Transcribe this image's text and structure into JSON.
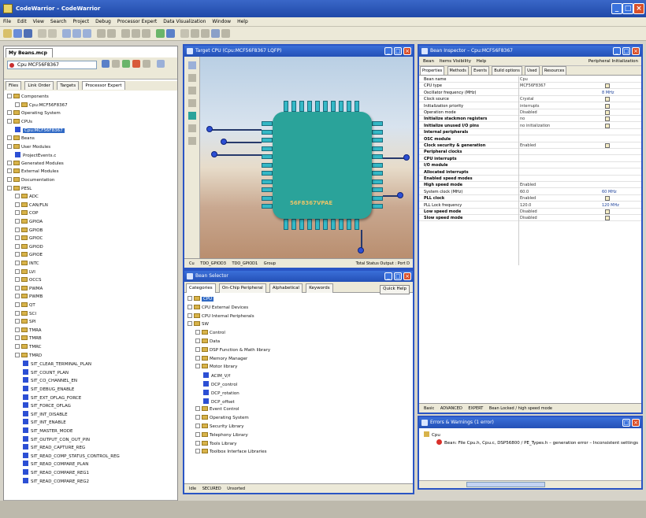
{
  "window": {
    "title": "CodeWarrior – CodeWarrior"
  },
  "menu": [
    "File",
    "Edit",
    "View",
    "Search",
    "Project",
    "Debug",
    "Processor Expert",
    "Data Visualization",
    "Window",
    "Help"
  ],
  "project_panel": {
    "tab": "My Beans.mcp",
    "cpu_select": "Cpu MCF56F8367",
    "subtabs": [
      "Files",
      "Link Order",
      "Targets",
      "Processor Expert"
    ],
    "tree": [
      {
        "label": "Components",
        "level": 0,
        "icon": "folder"
      },
      {
        "label": "Cpu:MCF56F8367",
        "level": 1,
        "icon": "folder"
      },
      {
        "label": "Operating System",
        "level": 0,
        "icon": "folder"
      },
      {
        "label": "CPUs",
        "level": 0,
        "icon": "folder"
      },
      {
        "label": "Cpu:MCF56F8367",
        "level": 1,
        "icon": "bean",
        "selected": true
      },
      {
        "label": "Beans",
        "level": 0,
        "icon": "folder"
      },
      {
        "label": "User Modules",
        "level": 0,
        "icon": "folder"
      },
      {
        "label": "ProjectEvents.c",
        "level": 1,
        "icon": "bean"
      },
      {
        "label": "Generated Modules",
        "level": 0,
        "icon": "folder"
      },
      {
        "label": "External Modules",
        "level": 0,
        "icon": "folder"
      },
      {
        "label": "Documentation",
        "level": 0,
        "icon": "folder"
      },
      {
        "label": "PESL",
        "level": 0,
        "icon": "folder"
      },
      {
        "label": "ADC",
        "level": 1,
        "icon": "folder"
      },
      {
        "label": "CAN/FLN",
        "level": 1,
        "icon": "folder"
      },
      {
        "label": "COP",
        "level": 1,
        "icon": "folder"
      },
      {
        "label": "GPIOA",
        "level": 1,
        "icon": "folder"
      },
      {
        "label": "GPIOB",
        "level": 1,
        "icon": "folder"
      },
      {
        "label": "GPIOC",
        "level": 1,
        "icon": "folder"
      },
      {
        "label": "GPIOD",
        "level": 1,
        "icon": "folder"
      },
      {
        "label": "GPIOE",
        "level": 1,
        "icon": "folder"
      },
      {
        "label": "INTC",
        "level": 1,
        "icon": "folder"
      },
      {
        "label": "LVI",
        "level": 1,
        "icon": "folder"
      },
      {
        "label": "OCCS",
        "level": 1,
        "icon": "folder"
      },
      {
        "label": "PWMA",
        "level": 1,
        "icon": "folder"
      },
      {
        "label": "PWMB",
        "level": 1,
        "icon": "folder"
      },
      {
        "label": "QT",
        "level": 1,
        "icon": "folder"
      },
      {
        "label": "SCI",
        "level": 1,
        "icon": "folder"
      },
      {
        "label": "SPI",
        "level": 1,
        "icon": "folder"
      },
      {
        "label": "TMRA",
        "level": 1,
        "icon": "folder"
      },
      {
        "label": "TMRB",
        "level": 1,
        "icon": "folder"
      },
      {
        "label": "TMRC",
        "level": 1,
        "icon": "folder"
      },
      {
        "label": "TMRD",
        "level": 1,
        "icon": "folder"
      },
      {
        "label": "SIT_CLEAR_TERMINAL_PLAN",
        "level": 2,
        "icon": "bean"
      },
      {
        "label": "SIT_COUNT_PLAN",
        "level": 2,
        "icon": "bean"
      },
      {
        "label": "SIT_CO_CHANNEL_EN",
        "level": 2,
        "icon": "bean"
      },
      {
        "label": "SIT_DEBUG_ENABLE",
        "level": 2,
        "icon": "bean"
      },
      {
        "label": "SIT_EXT_OFLAG_FORCE",
        "level": 2,
        "icon": "bean"
      },
      {
        "label": "SIT_FORCE_OFLAG",
        "level": 2,
        "icon": "bean"
      },
      {
        "label": "SIT_INT_DISABLE",
        "level": 2,
        "icon": "bean"
      },
      {
        "label": "SIT_INT_ENABLE",
        "level": 2,
        "icon": "bean"
      },
      {
        "label": "SIT_MASTER_MODE",
        "level": 2,
        "icon": "bean"
      },
      {
        "label": "SIT_OUTPUT_CON_OUT_PIN",
        "level": 2,
        "icon": "bean"
      },
      {
        "label": "SIT_READ_CAPTURE_REG",
        "level": 2,
        "icon": "bean"
      },
      {
        "label": "SIT_READ_COMP_STATUS_CONTROL_REG",
        "level": 2,
        "icon": "bean"
      },
      {
        "label": "SIT_READ_COMPARE_PLAN",
        "level": 2,
        "icon": "bean"
      },
      {
        "label": "SIT_READ_COMPARE_REG1",
        "level": 2,
        "icon": "bean"
      },
      {
        "label": "SIT_READ_COMPARE_REG2",
        "level": 2,
        "icon": "bean"
      }
    ]
  },
  "target_window": {
    "title": "Target CPU (Cpu:MCF56F8367 LQFP)",
    "chip_label": "56F8367VPAE",
    "status": [
      "Cu",
      "TDO_GPIOD3",
      "TDO_GPIOD1",
      "Group",
      "Total Status Output : Port D"
    ]
  },
  "bean_selector": {
    "title": "Bean Selector",
    "tabs": [
      "Categories",
      "On-Chip Peripheral",
      "Alphabetical",
      "Keywords"
    ],
    "help_label": "Quick Help",
    "tree": [
      {
        "label": "CPU",
        "level": 0,
        "icon": "folder",
        "selected": true
      },
      {
        "label": "CPU External Devices",
        "level": 0,
        "icon": "folder"
      },
      {
        "label": "CPU Internal Peripherals",
        "level": 0,
        "icon": "folder"
      },
      {
        "label": "SW",
        "level": 0,
        "icon": "folder"
      },
      {
        "label": "Control",
        "level": 1,
        "icon": "folder"
      },
      {
        "label": "Data",
        "level": 1,
        "icon": "folder"
      },
      {
        "label": "DSP Function & Math library",
        "level": 1,
        "icon": "folder"
      },
      {
        "label": "Memory Manager",
        "level": 1,
        "icon": "folder"
      },
      {
        "label": "Motor library",
        "level": 1,
        "icon": "folder"
      },
      {
        "label": "ACIM_V/f",
        "level": 2,
        "icon": "bean"
      },
      {
        "label": "DCP_control",
        "level": 2,
        "icon": "bean"
      },
      {
        "label": "DCP_rotation",
        "level": 2,
        "icon": "bean"
      },
      {
        "label": "DCP_offset",
        "level": 2,
        "icon": "bean"
      },
      {
        "label": "Event Control",
        "level": 1,
        "icon": "folder"
      },
      {
        "label": "Operating System",
        "level": 1,
        "icon": "folder"
      },
      {
        "label": "Security Library",
        "level": 1,
        "icon": "folder"
      },
      {
        "label": "Telephony Library",
        "level": 1,
        "icon": "folder"
      },
      {
        "label": "Tools Library",
        "level": 1,
        "icon": "folder"
      },
      {
        "label": "Toolbox Interface Libraries",
        "level": 1,
        "icon": "folder"
      }
    ],
    "status": [
      "Idle",
      "SECURED",
      "Unsorted"
    ]
  },
  "inspector": {
    "title": "Bean Inspector – Cpu:MCF56F8367",
    "toolbar": [
      "Bean",
      "Items Visibility",
      "Help"
    ],
    "toolbar_right": "Peripheral Initialization",
    "tabs": [
      "Properties",
      "Methods",
      "Events",
      "Build options",
      "Used",
      "Resources"
    ],
    "rows": [
      {
        "name": "Bean name",
        "value": "Cpu",
        "extra": "",
        "bold": false,
        "box": false
      },
      {
        "name": "CPU type",
        "value": "MCF56F8367",
        "extra": "",
        "bold": false,
        "box": true
      },
      {
        "name": "Oscillator frequency (MHz)",
        "value": "",
        "extra": "8 MHz",
        "bold": false,
        "box": false
      },
      {
        "name": "Clock source",
        "value": "Crystal",
        "extra": "",
        "bold": false,
        "box": true
      },
      {
        "name": "Initialization priority",
        "value": "interrupts",
        "extra": "",
        "bold": false,
        "box": true
      },
      {
        "name": "Operation mode",
        "value": "Disabled",
        "extra": "",
        "bold": false,
        "box": true
      },
      {
        "name": "Initialize stackmon registers",
        "value": "no",
        "extra": "",
        "bold": true,
        "box": true
      },
      {
        "name": "Initialize unused I/O pins",
        "value": "no initialization",
        "extra": "",
        "bold": true,
        "box": true
      },
      {
        "name": "Internal peripherals",
        "value": "",
        "extra": "",
        "bold": true,
        "box": false
      },
      {
        "name": "OSC module",
        "value": "",
        "extra": "",
        "bold": true,
        "box": false
      },
      {
        "name": "Clock security & generation",
        "value": "Enabled",
        "extra": "",
        "bold": true,
        "box": true
      },
      {
        "name": "Peripheral clocks",
        "value": "",
        "extra": "",
        "bold": true,
        "box": false
      },
      {
        "name": "CPU interrupts",
        "value": "",
        "extra": "",
        "bold": true,
        "box": false
      },
      {
        "name": "I/O module",
        "value": "",
        "extra": "",
        "bold": true,
        "box": false
      },
      {
        "name": "Allocated interrupts",
        "value": "",
        "extra": "",
        "bold": true,
        "box": false
      },
      {
        "name": "Enabled speed modes",
        "value": "",
        "extra": "",
        "bold": true,
        "box": false
      },
      {
        "name": "High speed mode",
        "value": "Enabled",
        "extra": "",
        "bold": true,
        "box": false
      },
      {
        "name": "System clock (MHz)",
        "value": "60.0",
        "extra": "60 MHz",
        "bold": false,
        "box": false
      },
      {
        "name": "PLL clock",
        "value": "Enabled",
        "extra": "",
        "bold": true,
        "box": true
      },
      {
        "name": "PLL Lock frequency",
        "value": "120.0",
        "extra": "120 MHz",
        "bold": false,
        "box": false
      },
      {
        "name": "Low speed mode",
        "value": "Disabled",
        "extra": "",
        "bold": true,
        "box": true
      },
      {
        "name": "Slow speed mode",
        "value": "Disabled",
        "extra": "",
        "bold": true,
        "box": true
      }
    ],
    "status": [
      "Basic",
      "ADVANCED",
      "EXPERT",
      "Bean Locked / high speed mode"
    ]
  },
  "errors_window": {
    "title": "Errors & Warnings (1 error)",
    "items": [
      {
        "label": "Cpu",
        "level": 0
      },
      {
        "label": "Bean: File Cpu.h, Cpu.c, DSP56800 / PE_Types.h – generation error – Inconsistent settings",
        "level": 1
      }
    ]
  },
  "colors": {
    "accent": "#2a55c4",
    "chip": "#2aa39a",
    "selection": "#316ac5"
  }
}
